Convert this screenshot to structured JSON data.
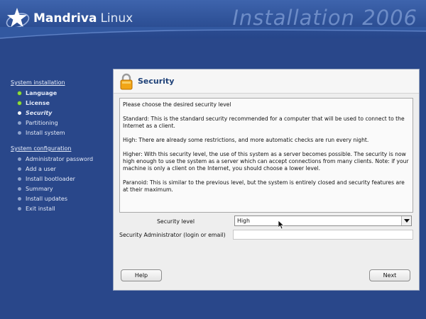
{
  "header": {
    "brand": "Mandriva",
    "product": "Linux",
    "installer_title": "Installation 2006"
  },
  "sidebar": {
    "section1": {
      "heading": "System installation",
      "items": [
        {
          "label": "Language",
          "state": "done"
        },
        {
          "label": "License",
          "state": "done"
        },
        {
          "label": "Security",
          "state": "current"
        },
        {
          "label": "Partitioning",
          "state": "todo"
        },
        {
          "label": "Install system",
          "state": "todo"
        }
      ]
    },
    "section2": {
      "heading": "System configuration",
      "items": [
        {
          "label": "Administrator password"
        },
        {
          "label": "Add a user"
        },
        {
          "label": "Install bootloader"
        },
        {
          "label": "Summary"
        },
        {
          "label": "Install updates"
        },
        {
          "label": "Exit install"
        }
      ]
    }
  },
  "panel": {
    "title": "Security",
    "description": [
      "Please choose the desired security level",
      "Standard: This is the standard security recommended for a computer that will be used to connect to the Internet as a client.",
      "High: There are already some restrictions, and more automatic checks are run every night.",
      "Higher: With this security level, the use of this system as a server becomes possible. The security is now high enough to use the system as a server which can accept connections from many clients. Note: if your machine is only a client on the Internet, you should choose a lower level.",
      "Paranoid: This is similar to the previous level, but the system is entirely closed and security features are at their maximum."
    ],
    "security_level_label": "Security level",
    "security_level_value": "High",
    "admin_label": "Security Administrator (login or email)",
    "admin_value": "",
    "help_label": "Help",
    "next_label": "Next"
  },
  "colors": {
    "background": "#29478a",
    "done_bullet": "#8fdc3d",
    "title": "#1e4178"
  },
  "icons": [
    "mandriva-star-icon",
    "lock-icon",
    "dropdown-arrow-icon",
    "mouse-pointer-icon"
  ]
}
